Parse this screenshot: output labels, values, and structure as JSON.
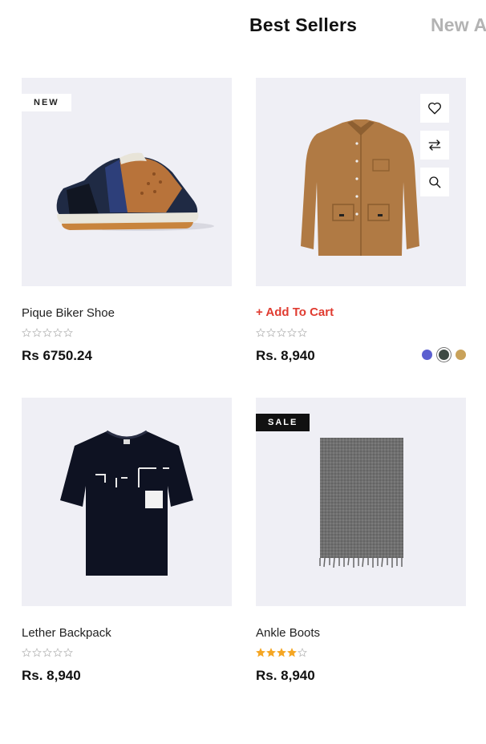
{
  "tabs": [
    {
      "label": "Best Sellers",
      "active": true
    },
    {
      "label": "New A",
      "active": false
    }
  ],
  "products": [
    {
      "name": "Pique Biker Shoe",
      "badge": "NEW",
      "price": "Rs 6750.24",
      "rating": 0,
      "image": "sneaker"
    },
    {
      "name": "",
      "add_to_cart": "+ Add To Cart",
      "price": "Rs. 8,940",
      "rating": 0,
      "image": "brown-jacket",
      "actions": [
        "heart-icon",
        "compare-icon",
        "search-icon"
      ],
      "swatches": [
        {
          "color": "#5b5fd0",
          "selected": false
        },
        {
          "color": "#3d4a44",
          "selected": true
        },
        {
          "color": "#c9a25a",
          "selected": false
        }
      ]
    },
    {
      "name": "Lether Backpack",
      "price": "Rs. 8,940",
      "rating": 0,
      "image": "black-tshirt"
    },
    {
      "name": "Ankle Boots",
      "badge": "SALE",
      "price": "Rs. 8,940",
      "rating": 4,
      "image": "grey-scarf"
    }
  ],
  "colors": {
    "star_filled": "#f5a623",
    "star_empty": "#bbbbbb",
    "add_to_cart": "#e03c31",
    "thumb_bg": "#efeff5"
  }
}
